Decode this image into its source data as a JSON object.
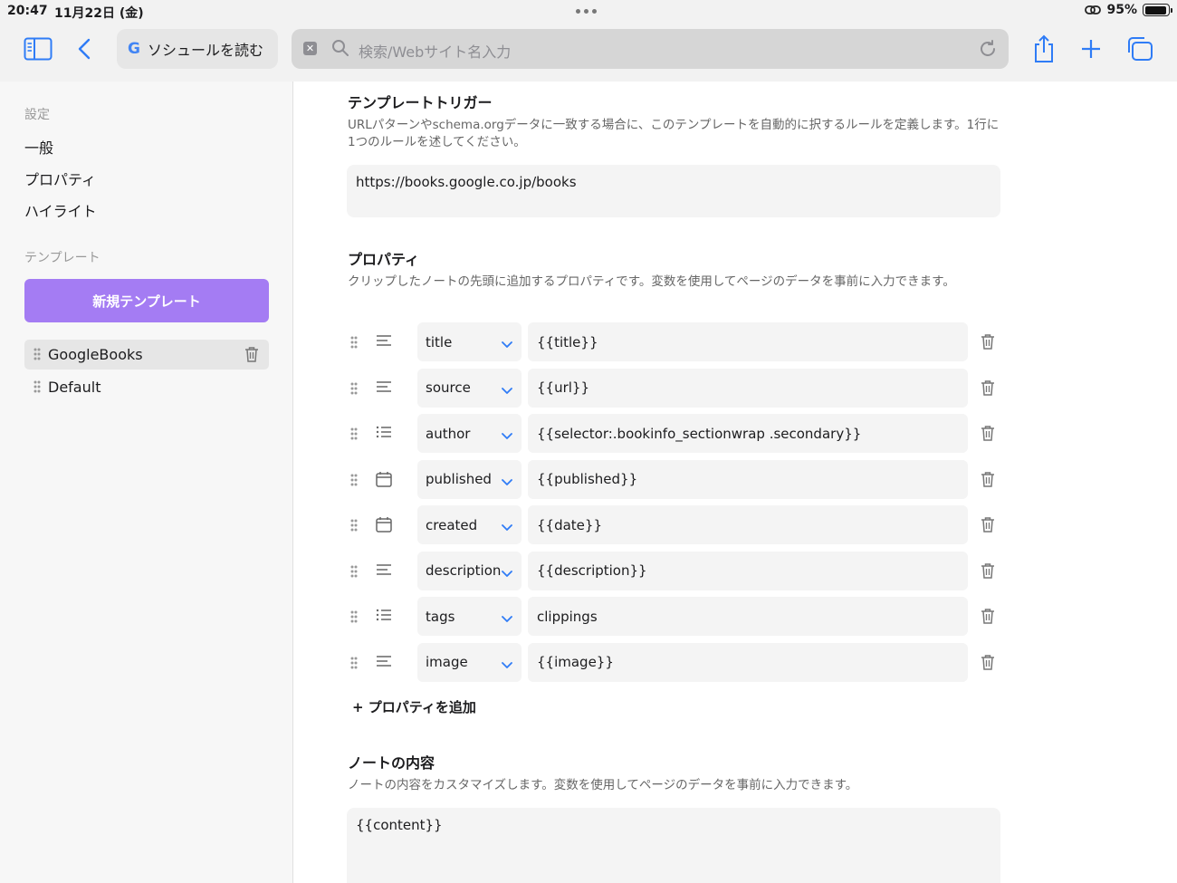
{
  "status": {
    "time": "20:47",
    "date": "11月22日 (金)",
    "battery": "95%",
    "battery_level": 0.95
  },
  "browser": {
    "tab_title": "ソシュールを読む",
    "tab_favicon": "G",
    "address_placeholder": "検索/Webサイト名入力",
    "accent": "#2f7cf6"
  },
  "sidebar": {
    "settings_label": "設定",
    "nav": [
      "一般",
      "プロパティ",
      "ハイライト"
    ],
    "templates_label": "テンプレート",
    "new_template_label": "新規テンプレート",
    "templates": [
      "GoogleBooks",
      "Default"
    ]
  },
  "trigger": {
    "title": "テンプレートトリガー",
    "description": "URLパターンやschema.orgデータに一致する場合に、このテンプレートを自動的に択するルールを定義します。1行に1つのルールを述してください。",
    "value": "https://books.google.co.jp/books"
  },
  "properties": {
    "title": "プロパティ",
    "description": "クリップしたノートの先頭に追加するプロパティです。変数を使用してページのデータを事前に入力できます。",
    "rows": [
      {
        "icon": "text-icon",
        "name": "title",
        "value": "{{title}}"
      },
      {
        "icon": "text-icon",
        "name": "source",
        "value": "{{url}}"
      },
      {
        "icon": "list-icon",
        "name": "author",
        "value": "{{selector:.bookinfo_sectionwrap .secondary}}"
      },
      {
        "icon": "calendar-icon",
        "name": "published",
        "value": "{{published}}"
      },
      {
        "icon": "calendar-icon",
        "name": "created",
        "value": "{{date}}"
      },
      {
        "icon": "text-icon",
        "name": "description",
        "value": "{{description}}"
      },
      {
        "icon": "list-icon",
        "name": "tags",
        "value": "clippings"
      },
      {
        "icon": "text-icon",
        "name": "image",
        "value": "{{image}}"
      }
    ],
    "add_label": "+ プロパティを追加"
  },
  "content": {
    "title": "ノートの内容",
    "description": "ノートの内容をカスタマイズします。変数を使用してページのデータを事前に入力できます。",
    "value": "{{content}}"
  }
}
